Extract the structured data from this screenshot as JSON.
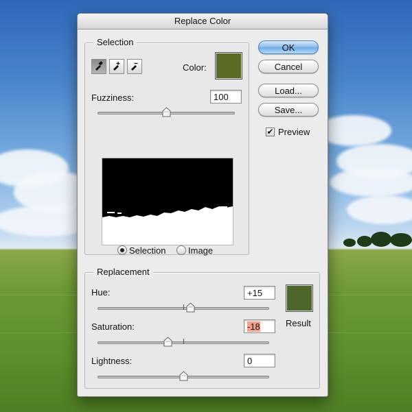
{
  "dialog": {
    "title": "Replace Color",
    "selection": {
      "group_label": "Selection",
      "color_label": "Color:",
      "color_hex": "#5b6b25",
      "fuzziness_label": "Fuzziness:",
      "fuzziness_value": "100",
      "fuzziness_fraction": 0.5,
      "view_options": {
        "selection_label": "Selection",
        "image_label": "Image",
        "selected": "Selection"
      },
      "tool_icons": [
        "eyedropper-icon",
        "eyedropper-plus-icon",
        "eyedropper-minus-icon"
      ]
    },
    "buttons": {
      "ok": "OK",
      "cancel": "Cancel",
      "load": "Load...",
      "save": "Save..."
    },
    "preview": {
      "label": "Preview",
      "checked": true,
      "check_mark": "✔"
    },
    "replacement": {
      "group_label": "Replacement",
      "hue_label": "Hue:",
      "hue_value": "+15",
      "saturation_label": "Saturation:",
      "saturation_value": "-18",
      "lightness_label": "Lightness:",
      "lightness_value": "0",
      "result_label": "Result",
      "result_hex": "#4b672a",
      "hue_fraction": 0.54,
      "saturation_fraction": 0.41,
      "lightness_fraction": 0.5
    }
  }
}
